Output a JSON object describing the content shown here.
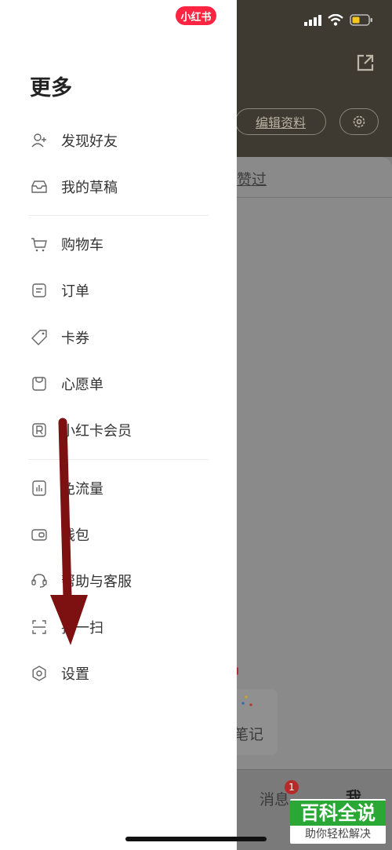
{
  "status_bar": {
    "signal": "signal-icon",
    "wifi": "wifi-icon",
    "battery": "battery-icon"
  },
  "brand": {
    "badge": "小红书"
  },
  "drawer": {
    "title": "更多",
    "groups": [
      [
        {
          "label": "发现好友",
          "icon": "add-friend-icon"
        },
        {
          "label": "我的草稿",
          "icon": "drafts-icon"
        }
      ],
      [
        {
          "label": "购物车",
          "icon": "cart-icon"
        },
        {
          "label": "订单",
          "icon": "order-icon"
        },
        {
          "label": "卡券",
          "icon": "coupon-icon"
        },
        {
          "label": "心愿单",
          "icon": "wishlist-icon"
        },
        {
          "label": "小红卡会员",
          "icon": "membership-icon"
        }
      ],
      [
        {
          "label": "免流量",
          "icon": "data-free-icon"
        },
        {
          "label": "钱包",
          "icon": "wallet-icon"
        },
        {
          "label": "帮助与客服",
          "icon": "support-icon"
        },
        {
          "label": "扫一扫",
          "icon": "scan-icon"
        },
        {
          "label": "设置",
          "icon": "settings-icon"
        }
      ]
    ]
  },
  "background_page": {
    "edit_profile": "编辑资料",
    "tab_liked": "赞过",
    "note_card_label": "笔记",
    "bottom_nav": {
      "messages": "消息",
      "messages_badge": "1",
      "me": "我"
    }
  },
  "watermark": {
    "title": "百科全说",
    "subtitle": "助你轻松解决"
  },
  "colors": {
    "brand_red": "#ff2442",
    "arrow": "#7d1010",
    "watermark_green": "#2aa835"
  }
}
